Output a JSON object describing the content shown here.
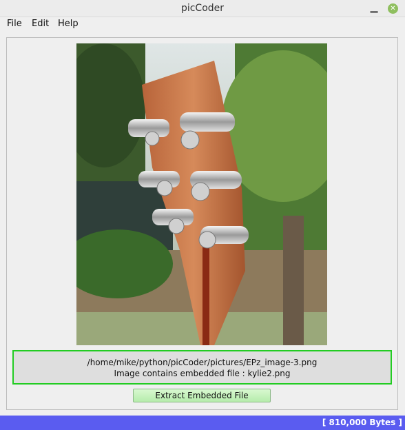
{
  "window": {
    "title": "picCoder"
  },
  "menubar": {
    "items": [
      "File",
      "Edit",
      "Help"
    ]
  },
  "image": {
    "subject": "guitar-headstock-photo"
  },
  "info": {
    "path": "/home/mike/python/picCoder/pictures/EPz_image-3.png",
    "message": "Image contains embedded file : kylie2.png",
    "border_color": "#22cc22"
  },
  "actions": {
    "extract_label": "Extract Embedded File"
  },
  "status": {
    "bytes_text": "[ 810,000 Bytes ]",
    "bar_color": "#5a5cf0"
  },
  "icons": {
    "minimize": "minimize-icon",
    "close": "close-icon"
  }
}
